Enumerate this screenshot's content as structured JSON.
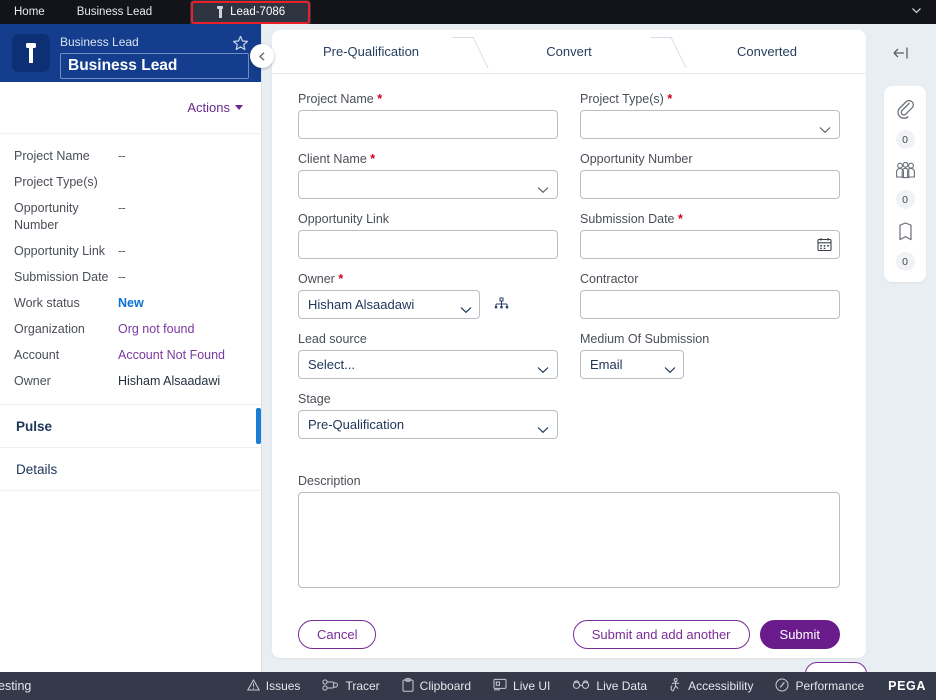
{
  "tabstrip": {
    "tabs": [
      {
        "label": "Home",
        "icon": "",
        "active": false
      },
      {
        "label": "Business Lead",
        "icon": "",
        "active": false
      },
      {
        "label": "Lead-7086",
        "icon": "torch-icon",
        "active": true
      }
    ],
    "caret_icon": "chevron-down-icon"
  },
  "left_panel": {
    "icon": "torch-icon",
    "subtitle": "Business Lead",
    "title": "Business Lead",
    "favorite_icon": "star-icon",
    "collapse_icon": "chevron-left-icon",
    "actions_label": "Actions",
    "fields": [
      {
        "label": "Project Name",
        "value": "--",
        "style": "dash"
      },
      {
        "label": "Project Type(s)",
        "value": "",
        "style": "dash"
      },
      {
        "label": "Opportunity Number",
        "value": "--",
        "style": "dash"
      },
      {
        "label": "Opportunity Link",
        "value": "--",
        "style": "dash"
      },
      {
        "label": "Submission Date",
        "value": "--",
        "style": "dash"
      },
      {
        "label": "Work status",
        "value": "New",
        "style": "blue"
      },
      {
        "label": "Organization",
        "value": "Org not found",
        "style": "purple"
      },
      {
        "label": "Account",
        "value": "Account Not Found",
        "style": "purple"
      },
      {
        "label": "Owner",
        "value": "Hisham Alsaadawi",
        "style": "plain"
      }
    ],
    "tabs": [
      {
        "label": "Pulse",
        "selected": true
      },
      {
        "label": "Details",
        "selected": false
      }
    ]
  },
  "main": {
    "stages": [
      {
        "label": "Pre-Qualification"
      },
      {
        "label": "Convert"
      },
      {
        "label": "Converted"
      }
    ],
    "form": {
      "project_name": {
        "label": "Project Name",
        "required": true,
        "value": ""
      },
      "project_types": {
        "label": "Project Type(s)",
        "required": true,
        "value": ""
      },
      "client_name": {
        "label": "Client Name",
        "required": true,
        "value": ""
      },
      "opportunity_number": {
        "label": "Opportunity Number",
        "required": false,
        "value": ""
      },
      "opportunity_link": {
        "label": "Opportunity Link",
        "required": false,
        "value": ""
      },
      "submission_date": {
        "label": "Submission Date",
        "required": true,
        "value": "",
        "icon": "calendar-icon"
      },
      "owner": {
        "label": "Owner",
        "required": true,
        "value": "Hisham Alsaadawi",
        "icon": "org-chart-icon"
      },
      "contractor": {
        "label": "Contractor",
        "required": false,
        "value": ""
      },
      "lead_source": {
        "label": "Lead source",
        "required": false,
        "value": "Select..."
      },
      "medium": {
        "label": "Medium Of Submission",
        "required": false,
        "value": "Email"
      },
      "stage": {
        "label": "Stage",
        "required": false,
        "value": "Pre-Qualification"
      },
      "description": {
        "label": "Description",
        "required": false,
        "value": ""
      }
    },
    "buttons": {
      "cancel": "Cancel",
      "submit_add_another": "Submit and add another",
      "submit": "Submit"
    },
    "collapse_right_icon": "collapse-left-icon"
  },
  "rail": [
    {
      "icon": "paperclip-icon",
      "count": "0"
    },
    {
      "icon": "people-icon",
      "count": "0"
    },
    {
      "icon": "tag-icon",
      "count": "0"
    }
  ],
  "devbar": {
    "left_label": "esting",
    "items": [
      {
        "label": "Issues",
        "icon": "warning-icon"
      },
      {
        "label": "Tracer",
        "icon": "tracer-icon"
      },
      {
        "label": "Clipboard",
        "icon": "clipboard-icon"
      },
      {
        "label": "Live UI",
        "icon": "live-ui-icon"
      },
      {
        "label": "Live Data",
        "icon": "live-data-icon"
      },
      {
        "label": "Accessibility",
        "icon": "accessibility-icon"
      },
      {
        "label": "Performance",
        "icon": "performance-icon"
      }
    ],
    "brand": "PEGA"
  },
  "colors": {
    "navy": "#143d8d",
    "purple": "#6a1b8c",
    "accent_blue": "#1a7fd4",
    "required_red": "#d0021b",
    "devbar": "#353a4a"
  }
}
